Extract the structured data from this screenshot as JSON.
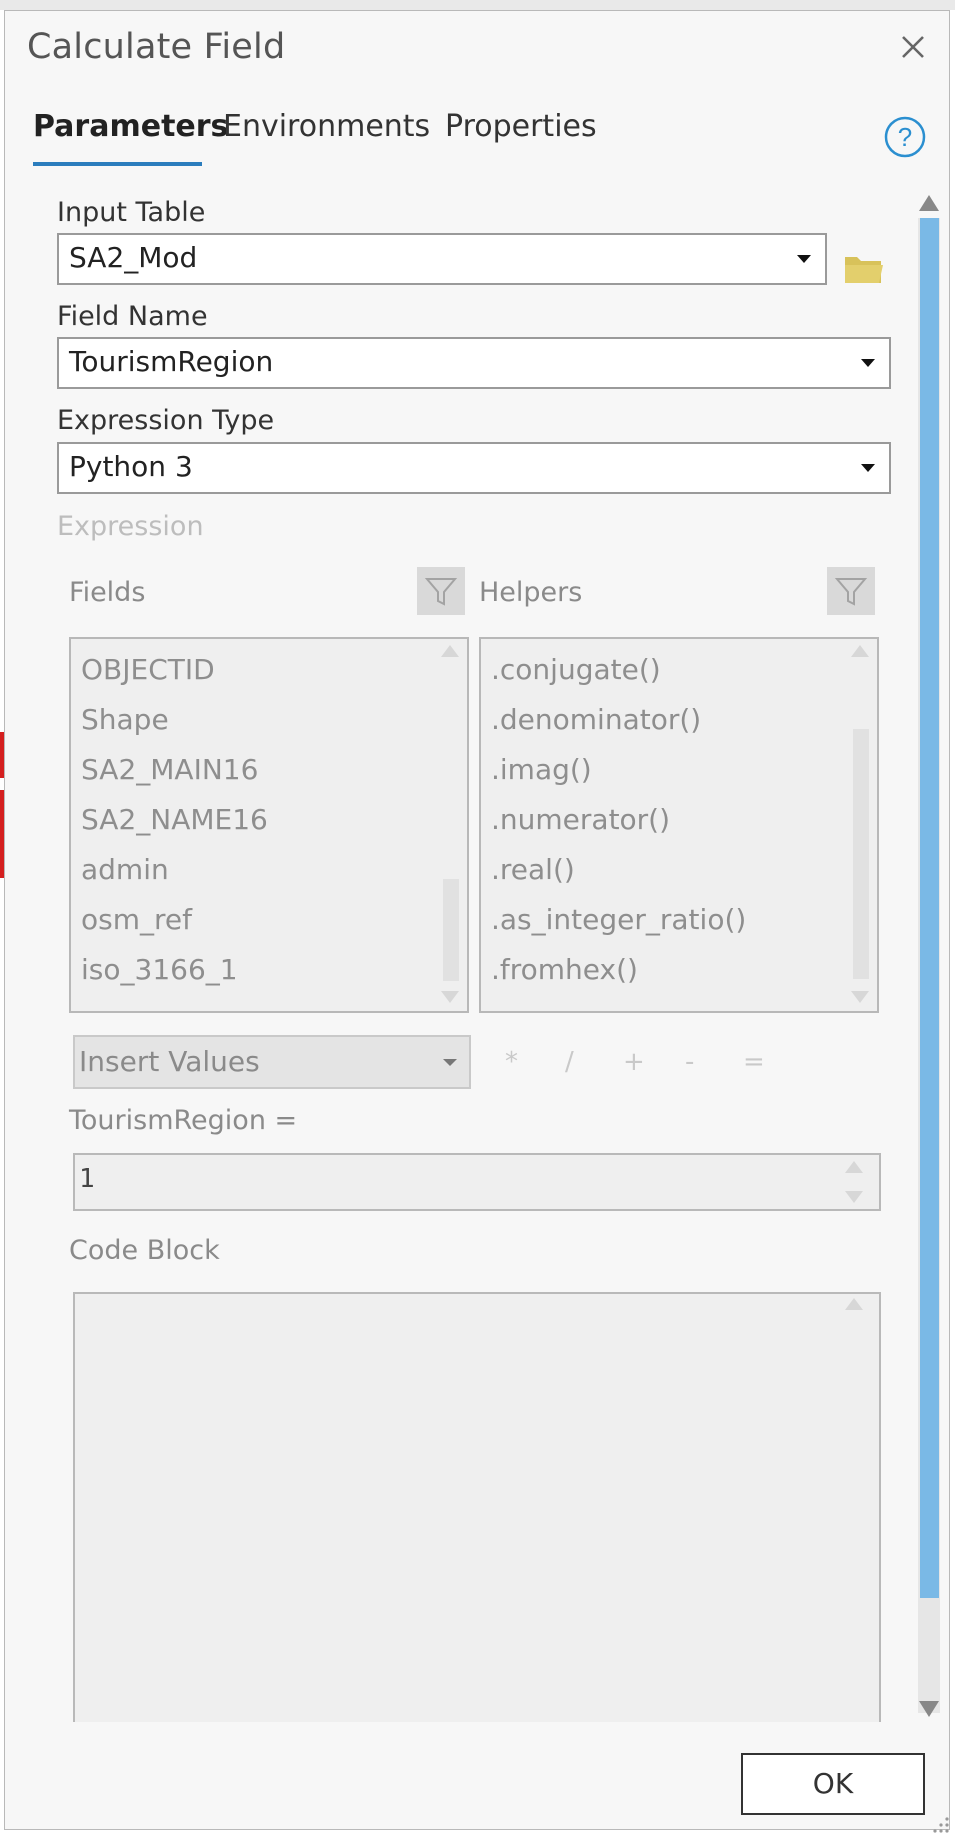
{
  "dialog": {
    "title": "Calculate Field"
  },
  "tabs": [
    {
      "label": "Parameters",
      "active": true
    },
    {
      "label": "Environments",
      "active": false
    },
    {
      "label": "Properties",
      "active": false
    }
  ],
  "input_table": {
    "label": "Input Table",
    "value": "SA2_Mod"
  },
  "field_name": {
    "label": "Field Name",
    "value": "TourismRegion"
  },
  "expression_type": {
    "label": "Expression Type",
    "value": "Python 3"
  },
  "expression": {
    "label": "Expression",
    "fields_label": "Fields",
    "helpers_label": "Helpers",
    "fields": [
      "OBJECTID",
      "Shape",
      "SA2_MAIN16",
      "SA2_NAME16",
      "admin",
      "osm_ref",
      "iso_3166_1"
    ],
    "helpers": [
      ".conjugate()",
      ".denominator()",
      ".imag()",
      ".numerator()",
      ".real()",
      ".as_integer_ratio()",
      ".fromhex()"
    ],
    "insert_values": "Insert Values",
    "operators": [
      "*",
      "/",
      "+",
      "-",
      "="
    ],
    "target_label": "TourismRegion =",
    "value": "1",
    "code_block_label": "Code Block",
    "code_block_value": ""
  },
  "buttons": {
    "ok": "OK"
  },
  "colors": {
    "accent": "#2b7dbd",
    "scrollbar": "#7ab9e6",
    "folder": "#d8c25a"
  },
  "icons": {
    "close": "close-icon",
    "help": "help-icon",
    "folder": "folder-icon",
    "filter": "filter-icon"
  }
}
